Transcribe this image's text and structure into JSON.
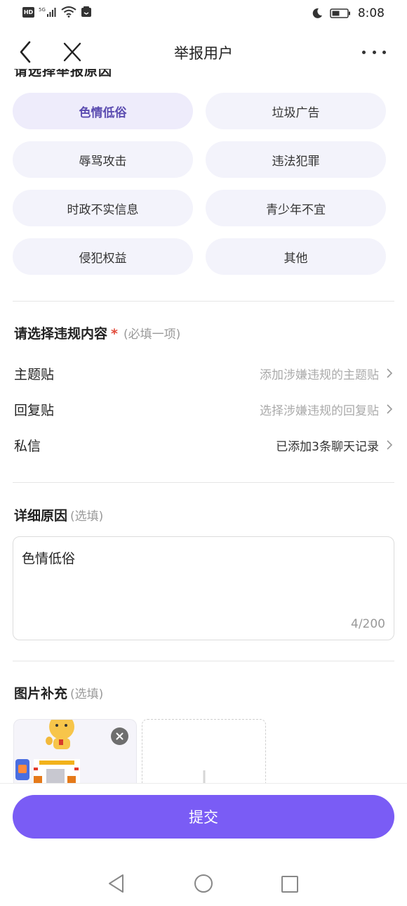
{
  "status_bar": {
    "left_badge": "HD",
    "signal_label": "5G",
    "time": "8:08"
  },
  "nav": {
    "title": "举报用户"
  },
  "partial_section_title": "请选择举报原因",
  "categories": [
    {
      "label": "色情低俗",
      "selected": true
    },
    {
      "label": "垃圾广告",
      "selected": false
    },
    {
      "label": "辱骂攻击",
      "selected": false
    },
    {
      "label": "违法犯罪",
      "selected": false
    },
    {
      "label": "时政不实信息",
      "selected": false
    },
    {
      "label": "青少年不宜",
      "selected": false
    },
    {
      "label": "侵犯权益",
      "selected": false
    },
    {
      "label": "其他",
      "selected": false
    }
  ],
  "violation_section": {
    "title": "请选择违规内容",
    "required_mark": "*",
    "hint": "(必填一项)",
    "rows": [
      {
        "label": "主题贴",
        "value": "添加涉嫌违规的主题贴",
        "filled": false
      },
      {
        "label": "回复贴",
        "value": "选择涉嫌违规的回复贴",
        "filled": false
      },
      {
        "label": "私信",
        "value": "已添加3条聊天记录",
        "filled": true
      }
    ]
  },
  "detail_section": {
    "title": "详细原因",
    "hint": "(选填)",
    "text": "色情低俗",
    "counter": "4/200"
  },
  "image_section": {
    "title": "图片补充",
    "hint": "(选填)"
  },
  "submit_label": "提交",
  "colors": {
    "accent": "#7a5cf5",
    "selected_chip_text": "#5a4bb0",
    "chip_bg": "#f3f3fb",
    "required": "#e24b3b"
  }
}
